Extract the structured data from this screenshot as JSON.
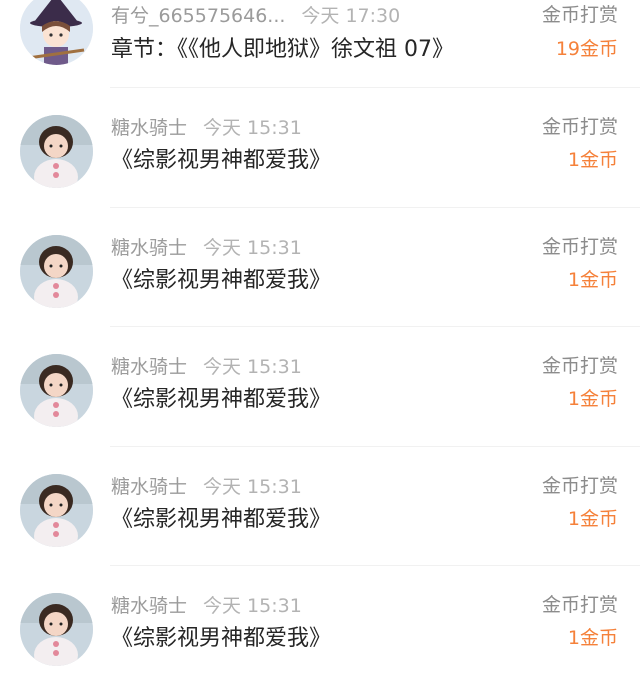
{
  "rows": [
    {
      "name": "有兮_665575646...",
      "time": "今天 17:30",
      "title": "章节：《《他人即地狱》徐文祖 07》",
      "reward_label": "金币打赏",
      "reward_amount": "19金币",
      "avatar": "witch-avatar"
    },
    {
      "name": "糖水骑士",
      "time": "今天 15:31",
      "title": "《综影视男神都爱我》",
      "reward_label": "金币打赏",
      "reward_amount": "1金币",
      "avatar": "child-avatar"
    },
    {
      "name": "糖水骑士",
      "time": "今天 15:31",
      "title": "《综影视男神都爱我》",
      "reward_label": "金币打赏",
      "reward_amount": "1金币",
      "avatar": "child-avatar"
    },
    {
      "name": "糖水骑士",
      "time": "今天 15:31",
      "title": "《综影视男神都爱我》",
      "reward_label": "金币打赏",
      "reward_amount": "1金币",
      "avatar": "child-avatar"
    },
    {
      "name": "糖水骑士",
      "time": "今天 15:31",
      "title": "《综影视男神都爱我》",
      "reward_label": "金币打赏",
      "reward_amount": "1金币",
      "avatar": "child-avatar"
    },
    {
      "name": "糖水骑士",
      "time": "今天 15:31",
      "title": "《综影视男神都爱我》",
      "reward_label": "金币打赏",
      "reward_amount": "1金币",
      "avatar": "child-avatar"
    }
  ],
  "colors": {
    "accent": "#f5813a",
    "name_text": "#9b9b9b",
    "title_text": "#262626"
  }
}
